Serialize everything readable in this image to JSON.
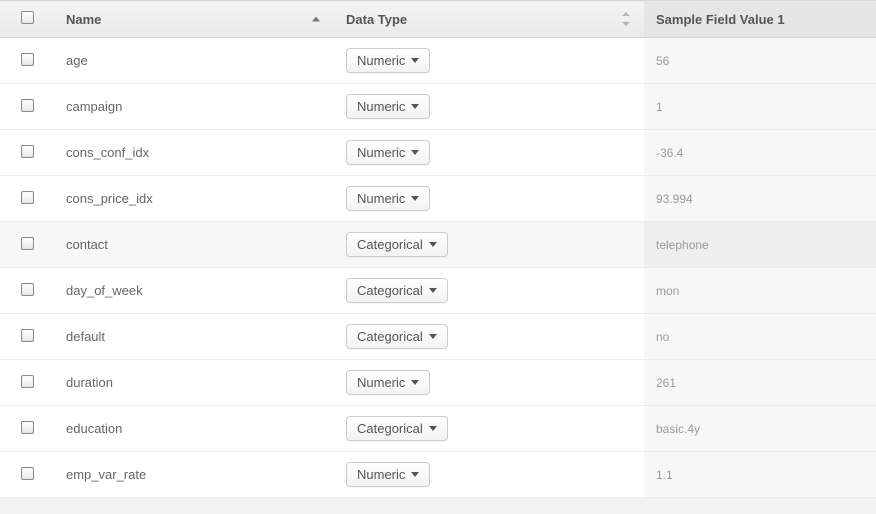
{
  "table": {
    "headers": {
      "name": "Name",
      "data_type": "Data Type",
      "sample": "Sample Field Value 1"
    },
    "rows": [
      {
        "name": "age",
        "data_type": "Numeric",
        "sample": "56",
        "selected": false
      },
      {
        "name": "campaign",
        "data_type": "Numeric",
        "sample": "1",
        "selected": false
      },
      {
        "name": "cons_conf_idx",
        "data_type": "Numeric",
        "sample": "-36.4",
        "selected": false
      },
      {
        "name": "cons_price_idx",
        "data_type": "Numeric",
        "sample": "93.994",
        "selected": false
      },
      {
        "name": "contact",
        "data_type": "Categorical",
        "sample": "telephone",
        "selected": true
      },
      {
        "name": "day_of_week",
        "data_type": "Categorical",
        "sample": "mon",
        "selected": false
      },
      {
        "name": "default",
        "data_type": "Categorical",
        "sample": "no",
        "selected": false
      },
      {
        "name": "duration",
        "data_type": "Numeric",
        "sample": "261",
        "selected": false
      },
      {
        "name": "education",
        "data_type": "Categorical",
        "sample": "basic.4y",
        "selected": false
      },
      {
        "name": "emp_var_rate",
        "data_type": "Numeric",
        "sample": "1.1",
        "selected": false
      }
    ]
  }
}
